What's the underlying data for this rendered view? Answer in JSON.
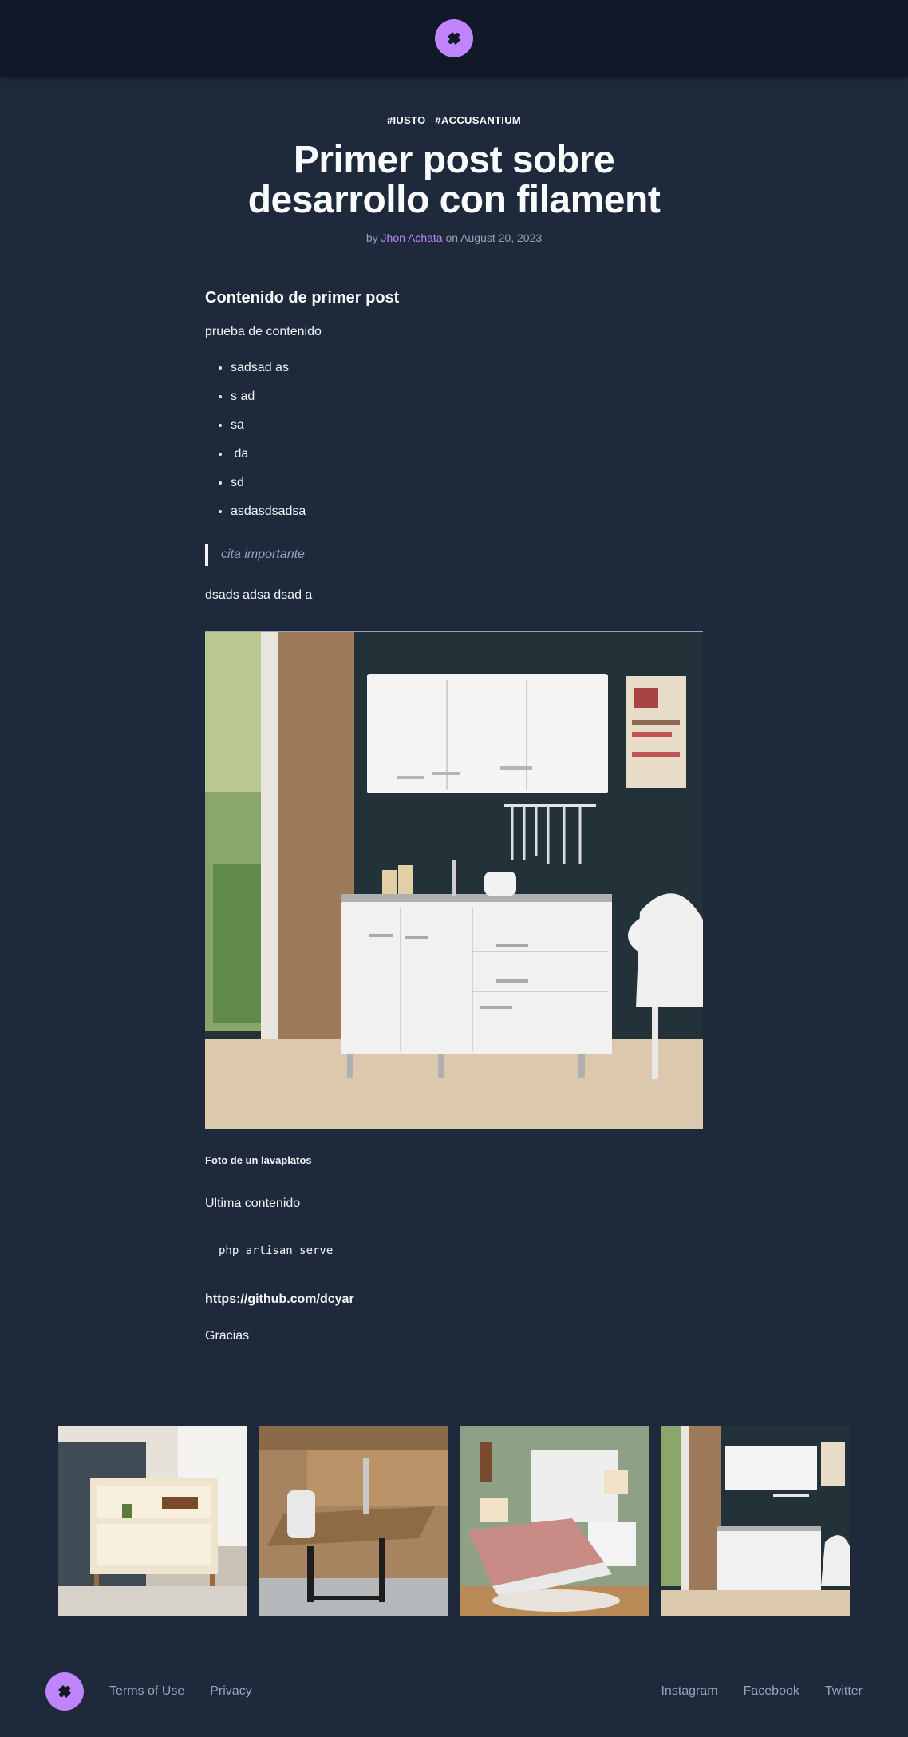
{
  "header": {
    "logo_icon": "puzzle-icon",
    "accent": "#c084fc"
  },
  "post": {
    "tags": [
      "#IUSTO",
      "#ACCUSANTIUM"
    ],
    "title": "Primer post sobre desarrollo con filament",
    "byline_prefix": "by",
    "author": "Jhon Achata",
    "byline_suffix": "on August 20, 2023",
    "heading": "Contenido de primer post",
    "intro": "prueba de contenido",
    "bullets": [
      "sadsad as",
      "s ad",
      "sa",
      " da",
      "sd",
      "asdasdsadsa"
    ],
    "quote": "cita importante",
    "paragraph2": "dsads adsa dsad a",
    "image_alt": "kitchen-sink-cabinet-photo",
    "caption": "Foto de un lavaplatos",
    "paragraph3": "Ultima contenido",
    "code": "php artisan serve",
    "link": "https://github.com/dcyar",
    "closing": "Gracias"
  },
  "gallery": [
    {
      "name": "living-room-shelf"
    },
    {
      "name": "office-desk"
    },
    {
      "name": "bedroom"
    },
    {
      "name": "kitchen-cabinet"
    }
  ],
  "footer": {
    "logo_icon": "puzzle-icon",
    "left_links": [
      "Terms of Use",
      "Privacy"
    ],
    "right_links": [
      "Instagram",
      "Facebook",
      "Twitter"
    ]
  }
}
